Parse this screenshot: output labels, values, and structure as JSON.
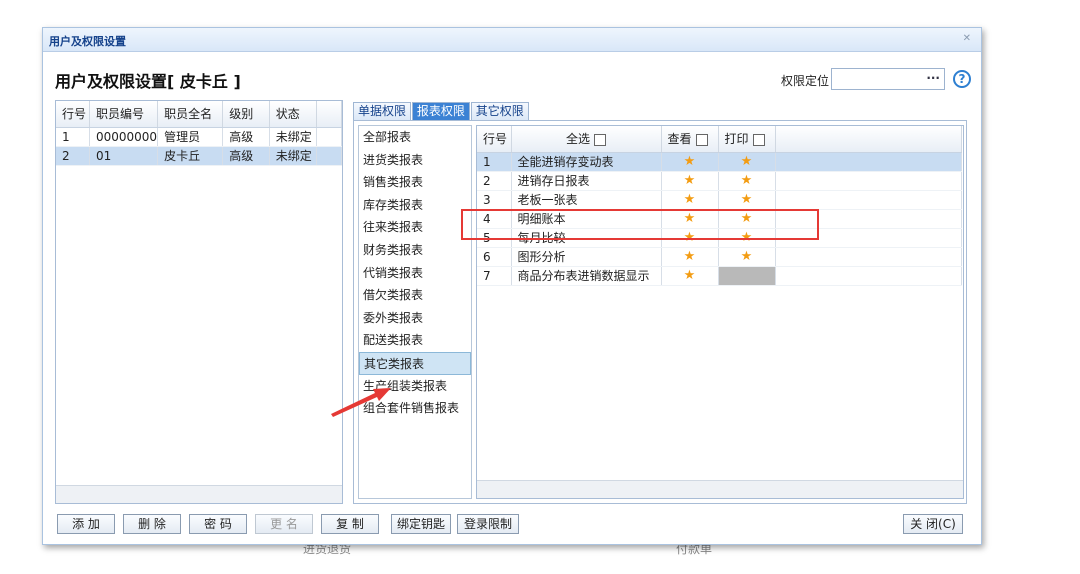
{
  "background": {
    "left_text": "进货退货",
    "right_text": "付款单"
  },
  "window": {
    "title": "用户及权限设置",
    "close_glyph": "✕"
  },
  "heading": "用户及权限设置[ 皮卡丘 ]",
  "locate": {
    "label": "权限定位",
    "value": "",
    "button": "···"
  },
  "help_icon": "?",
  "users": {
    "columns": [
      "行号",
      "职员编号",
      "职员全名",
      "级别",
      "状态"
    ],
    "rows": [
      [
        "1",
        "00000000",
        "管理员",
        "高级",
        "未绑定"
      ],
      [
        "2",
        "01",
        "皮卡丘",
        "高级",
        "未绑定"
      ]
    ],
    "selected_row": 1
  },
  "tabs": [
    "单据权限",
    "报表权限",
    "其它权限"
  ],
  "active_tab": 1,
  "categories": [
    "全部报表",
    "进货类报表",
    "销售类报表",
    "库存类报表",
    "往来类报表",
    "财务类报表",
    "代销类报表",
    "借欠类报表",
    "委外类报表",
    "配送类报表",
    "其它类报表",
    "生产组装类报表",
    "组合套件销售报表"
  ],
  "selected_category": 10,
  "reports": {
    "columns": {
      "row_no": "行号",
      "select_all": "全选",
      "view": "查看",
      "print": "打印"
    },
    "rows": [
      {
        "no": "1",
        "name": "全能进销存变动表",
        "view": "★",
        "print": "★"
      },
      {
        "no": "2",
        "name": "进销存日报表",
        "view": "★",
        "print": "★"
      },
      {
        "no": "3",
        "name": "老板一张表",
        "view": "★",
        "print": "★"
      },
      {
        "no": "4",
        "name": "明细账本",
        "view": "★",
        "print": "★"
      },
      {
        "no": "5",
        "name": "每月比较",
        "view": "★",
        "print": "★"
      },
      {
        "no": "6",
        "name": "图形分析",
        "view": "★",
        "print": "★"
      },
      {
        "no": "7",
        "name": "商品分布表进销数据显示",
        "view": "★",
        "print": ""
      }
    ],
    "selected_row": 0
  },
  "colors": {
    "star": "#f39c12",
    "highlight": "#e53935",
    "arrow": "#e53935",
    "accent": "#3c82d4"
  },
  "buttons": {
    "add": "添 加",
    "delete": "删 除",
    "password": "密 码",
    "rename": "更 名",
    "copy": "复 制",
    "bind_key": "绑定钥匙",
    "login_limit": "登录限制",
    "close": "关 闭(C)"
  }
}
